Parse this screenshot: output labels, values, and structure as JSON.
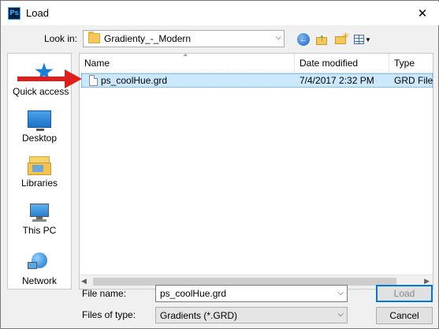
{
  "window": {
    "title": "Load",
    "app_icon": "Ps",
    "close_glyph": "✕"
  },
  "lookin": {
    "label": "Look in:",
    "value": "Gradienty_-_Modern"
  },
  "places": [
    {
      "label": "Quick access",
      "icon": "star-icon"
    },
    {
      "label": "Desktop",
      "icon": "desktop-icon"
    },
    {
      "label": "Libraries",
      "icon": "libraries-icon"
    },
    {
      "label": "This PC",
      "icon": "this-pc-icon"
    },
    {
      "label": "Network",
      "icon": "network-icon"
    }
  ],
  "columns": {
    "name": "Name",
    "date": "Date modified",
    "type": "Type"
  },
  "files": [
    {
      "name": "ps_coolHue.grd",
      "date": "7/4/2017 2:32 PM",
      "type": "GRD File"
    }
  ],
  "filename": {
    "label": "File name:",
    "value": "ps_coolHue.grd"
  },
  "filetype": {
    "label": "Files of type:",
    "value": "Gradients (*.GRD)"
  },
  "buttons": {
    "load": "Load",
    "cancel": "Cancel"
  },
  "colors": {
    "selection": "#cce8ff",
    "arrow": "#e01e1e",
    "focus": "#0078d7"
  }
}
